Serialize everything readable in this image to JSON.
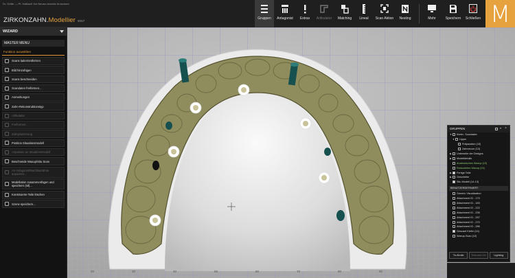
{
  "app": {
    "breadcrumb": "Dr. Gräfe — Pt. Halbach Vor Neuss ceramic bruschure",
    "title_main": "ZIRKONZAHN.",
    "title_accent": "Modellier",
    "version": "9067"
  },
  "toolbar": {
    "items": [
      {
        "name": "gruppen",
        "label": "Gruppen",
        "icon": "menu-icon",
        "active": true
      },
      {
        "name": "antagonist",
        "label": "Antagonist",
        "icon": "antagonist-icon"
      },
      {
        "name": "extras",
        "label": "Extras",
        "icon": "exclamation-icon"
      },
      {
        "name": "artikulator",
        "label": "Artikulator",
        "icon": "articulator-icon",
        "disabled": true
      },
      {
        "name": "matching",
        "label": "Matching",
        "icon": "matching-icon"
      },
      {
        "name": "lineal",
        "label": "Lineal",
        "icon": "ruler-icon"
      },
      {
        "name": "scan-aktion",
        "label": "Scan Aktion",
        "icon": "scan-icon"
      },
      {
        "name": "nesting",
        "label": "Nesting",
        "icon": "nesting-icon"
      }
    ],
    "right_items": [
      {
        "name": "mehr",
        "label": "Mehr",
        "icon": "monitor-icon"
      },
      {
        "name": "speichern",
        "label": "Speichern",
        "icon": "save-icon"
      },
      {
        "name": "schliessen",
        "label": "Schließen",
        "icon": "power-icon"
      }
    ],
    "logo_letter": "M"
  },
  "wizard": {
    "title": "WIZARD",
    "master_menu": "MASTER MENU",
    "function_label": "Funktion auswählen",
    "items": [
      {
        "label": "Scans laden/entfernen"
      },
      {
        "label": "Bild hinzufügen"
      },
      {
        "label": "Scans beschneiden"
      },
      {
        "label": "Scandaten freiformen..."
      },
      {
        "label": "Anmerkungen"
      },
      {
        "label": "Zahn-Rekonstruktionstyp"
      },
      {
        "label": "Artikulator",
        "disabled": true
      },
      {
        "label": "Freiformen...",
        "disabled": true
      },
      {
        "label": "Zahnplatzierung",
        "disabled": true
      },
      {
        "label": "Position Situationsmodell"
      },
      {
        "label": "Anpassen an Situationsmodell",
        "disabled": true
      },
      {
        "label": "Beschneide Waxup/Situ Scan"
      },
      {
        "label": "An Antagonist/Nachbarzähne anpassen...",
        "disabled": true,
        "double": true
      },
      {
        "label": "Modellation zusammenfügen und speichern (stl)...",
        "double": true
      },
      {
        "label": "Konstruierte Teile löschen"
      },
      {
        "label": "Szene speichern..."
      }
    ]
  },
  "groups": {
    "title": "GRUPPEN",
    "tree": [
      {
        "label": "Kiefer- Scandaten",
        "level": 0,
        "tri": "▼"
      },
      {
        "label": "Upper",
        "level": 1,
        "tri": "▼"
      },
      {
        "label": "Präparation (13)",
        "level": 2
      },
      {
        "label": "Zahnrecon (13)",
        "level": 2
      },
      {
        "label": "Unterseite der Designs",
        "level": 0,
        "tri": "▶"
      },
      {
        "label": "Modelldetails",
        "level": 0,
        "tri": "▶"
      },
      {
        "label": "Anatomisches Waxup (13)",
        "level": 0,
        "green": true
      },
      {
        "label": "Reduziertes Waxup (13)",
        "level": 0,
        "green": true
      },
      {
        "label": "Fertige Teile",
        "level": 0,
        "tri": "▶",
        "checked": true
      },
      {
        "label": "Geschiebe",
        "level": 0,
        "tri": "▶"
      },
      {
        "label": "Situ Modell (14-13)",
        "level": 0,
        "checked": true
      }
    ],
    "custom_head": "BENUTZERDEFINIERT",
    "custom": [
      {
        "label": "Generic Visualization"
      },
      {
        "label": "Attachment ID - 170"
      },
      {
        "label": "Attachment ID - 183"
      },
      {
        "label": "Attachment ID - 222"
      },
      {
        "label": "Attachment ID - 235"
      },
      {
        "label": "Attachment ID - 257"
      },
      {
        "label": "Attachment ID - 270"
      },
      {
        "label": "Attachment ID - 286"
      },
      {
        "label": "Gescant Kiefer (14)",
        "checked": true
      },
      {
        "label": "Waxup-Scan (13)"
      }
    ],
    "buttons": [
      {
        "label": "TruSmile"
      },
      {
        "label": "Textures On",
        "disabled": true
      },
      {
        "label": "Lighting"
      }
    ]
  },
  "ruler": {
    "ticks": [
      "20",
      "30",
      "40",
      "50",
      "60",
      "70",
      "80",
      "90"
    ]
  },
  "colors": {
    "accent": "#e6a23e",
    "model": "#8f8c5e",
    "implant": "#16504f"
  }
}
